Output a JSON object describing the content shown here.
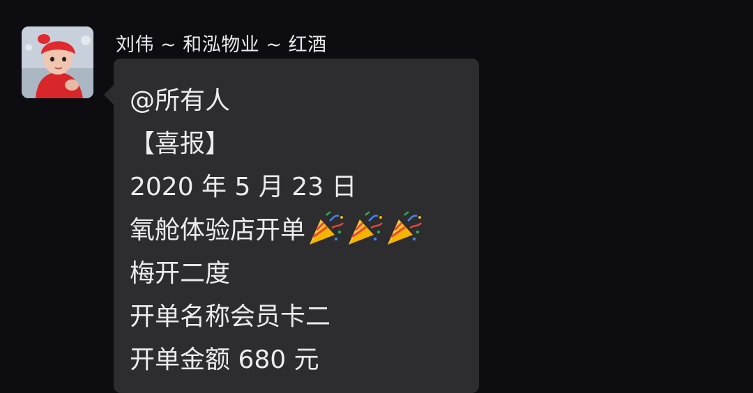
{
  "message": {
    "sender": "刘伟 ~ 和泓物业 ~ 红酒",
    "lines": [
      "@所有人",
      "【喜报】",
      "2020 年 5 月 23 日",
      "氧舱体验店开单",
      "梅开二度",
      "开单名称会员卡二",
      "开单金额 680 元"
    ],
    "emoji": [
      "party-popper-icon",
      "party-popper-icon",
      "party-popper-icon"
    ]
  },
  "colors": {
    "background": "#0c0c11",
    "bubble": "#2d2d30",
    "text": "#ececf0",
    "sender_text": "#e9e9ee"
  }
}
